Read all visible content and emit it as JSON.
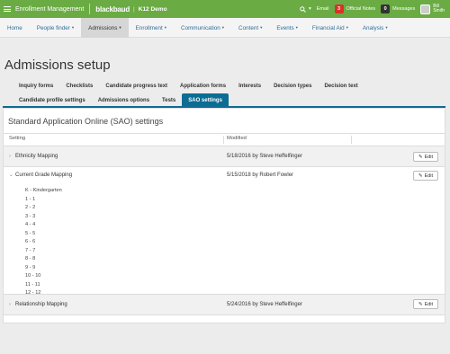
{
  "topbar": {
    "app_title": "Enrollment Management",
    "logo": "blackbaud",
    "logo_sep": "|",
    "school": "K12 Demo",
    "search_caret": "▾",
    "email": "Email",
    "official_notes_count": "3",
    "official_notes": "Official Notes",
    "messages_count": "0",
    "messages": "Messages",
    "user_line1": "Bill",
    "user_line2": "Smith"
  },
  "nav": {
    "items": [
      {
        "label": "Home",
        "caret": ""
      },
      {
        "label": "People finder",
        "caret": "▾"
      },
      {
        "label": "Admissions",
        "caret": "▾"
      },
      {
        "label": "Enrollment",
        "caret": "▾"
      },
      {
        "label": "Communication",
        "caret": "▾"
      },
      {
        "label": "Content",
        "caret": "▾"
      },
      {
        "label": "Events",
        "caret": "▾"
      },
      {
        "label": "Financial Aid",
        "caret": "▾"
      },
      {
        "label": "Analysis",
        "caret": "▾"
      }
    ]
  },
  "page": {
    "title": "Admissions setup"
  },
  "tabs": {
    "row1": [
      "Inquiry forms",
      "Checklists",
      "Candidate progress text",
      "Application forms",
      "Interests",
      "Decision types",
      "Decision text"
    ],
    "row2": [
      "Candidate profile settings",
      "Admissions options",
      "Tests",
      "SAO settings"
    ]
  },
  "panel": {
    "title": "Standard Application Online (SAO) settings",
    "col_setting": "Setting",
    "col_modified": "Modified",
    "edit_label": "Edit",
    "rows": [
      {
        "chevron": "›",
        "label": "Ethnicity Mapping",
        "modified": "5/18/2016 by Steve Heffelfinger"
      },
      {
        "chevron": "⌄",
        "label": "Current Grade Mapping",
        "modified": "5/15/2018 by Robert Fowler"
      },
      {
        "chevron": "›",
        "label": "Relationship Mapping",
        "modified": "5/24/2016 by Steve Heffelfinger"
      }
    ],
    "grade_mapping": [
      "K - Kindergarten",
      "1 - 1",
      "2 - 2",
      "3 - 3",
      "4 - 4",
      "5 - 5",
      "6 - 6",
      "7 - 7",
      "8 - 8",
      "9 - 9",
      "10 - 10",
      "11 - 11",
      "12 - 12"
    ]
  }
}
